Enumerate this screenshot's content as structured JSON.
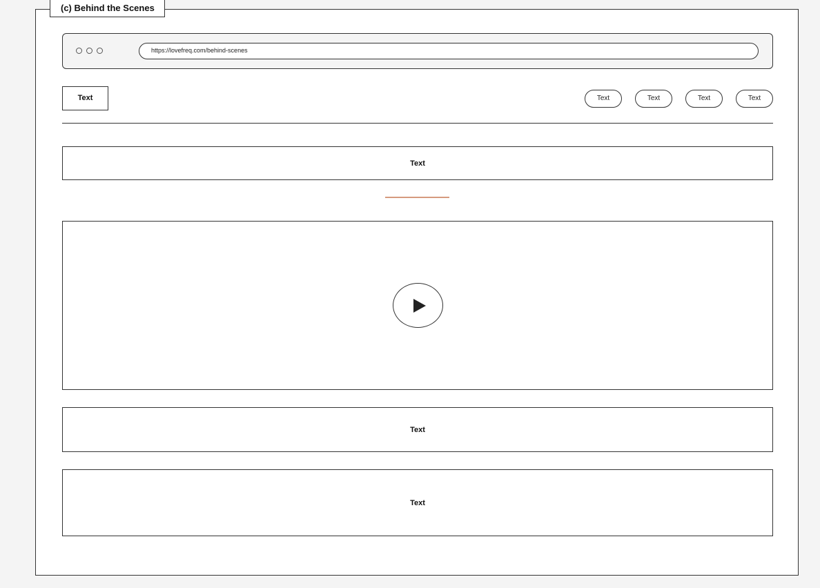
{
  "figure": {
    "label": "(c) Behind the Scenes"
  },
  "browser": {
    "url": "https://lovefreq.com/behind-scenes"
  },
  "header": {
    "logo_text": "Text",
    "nav_items": [
      "Text",
      "Text",
      "Text",
      "Text"
    ]
  },
  "sections": {
    "title_bar": "Text",
    "text_block_1": "Text",
    "text_block_2": "Text"
  },
  "colors": {
    "accent": "#d69a7e",
    "stroke": "#333333",
    "background": "#f4f4f4"
  },
  "icons": {
    "video": "play-icon"
  }
}
